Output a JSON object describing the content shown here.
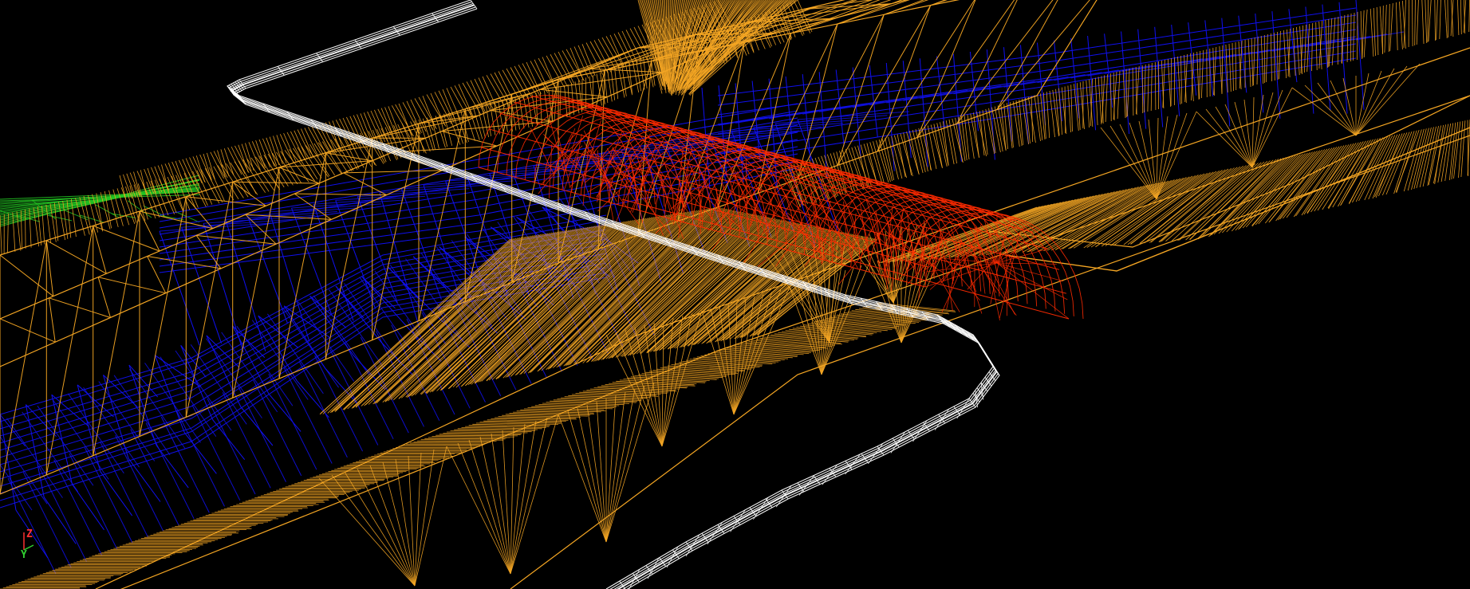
{
  "viewport": {
    "background": "#000000",
    "colors": {
      "terrain": "#F5A623",
      "structure": "#1010F0",
      "tunnel": "#FF2A00",
      "road": "#FFFFFF",
      "ground": "#22C422"
    }
  },
  "axis_gizmo": {
    "z_label": "Z",
    "y_label": "Y",
    "z_color": "#FF3030",
    "y_color": "#30D030"
  }
}
